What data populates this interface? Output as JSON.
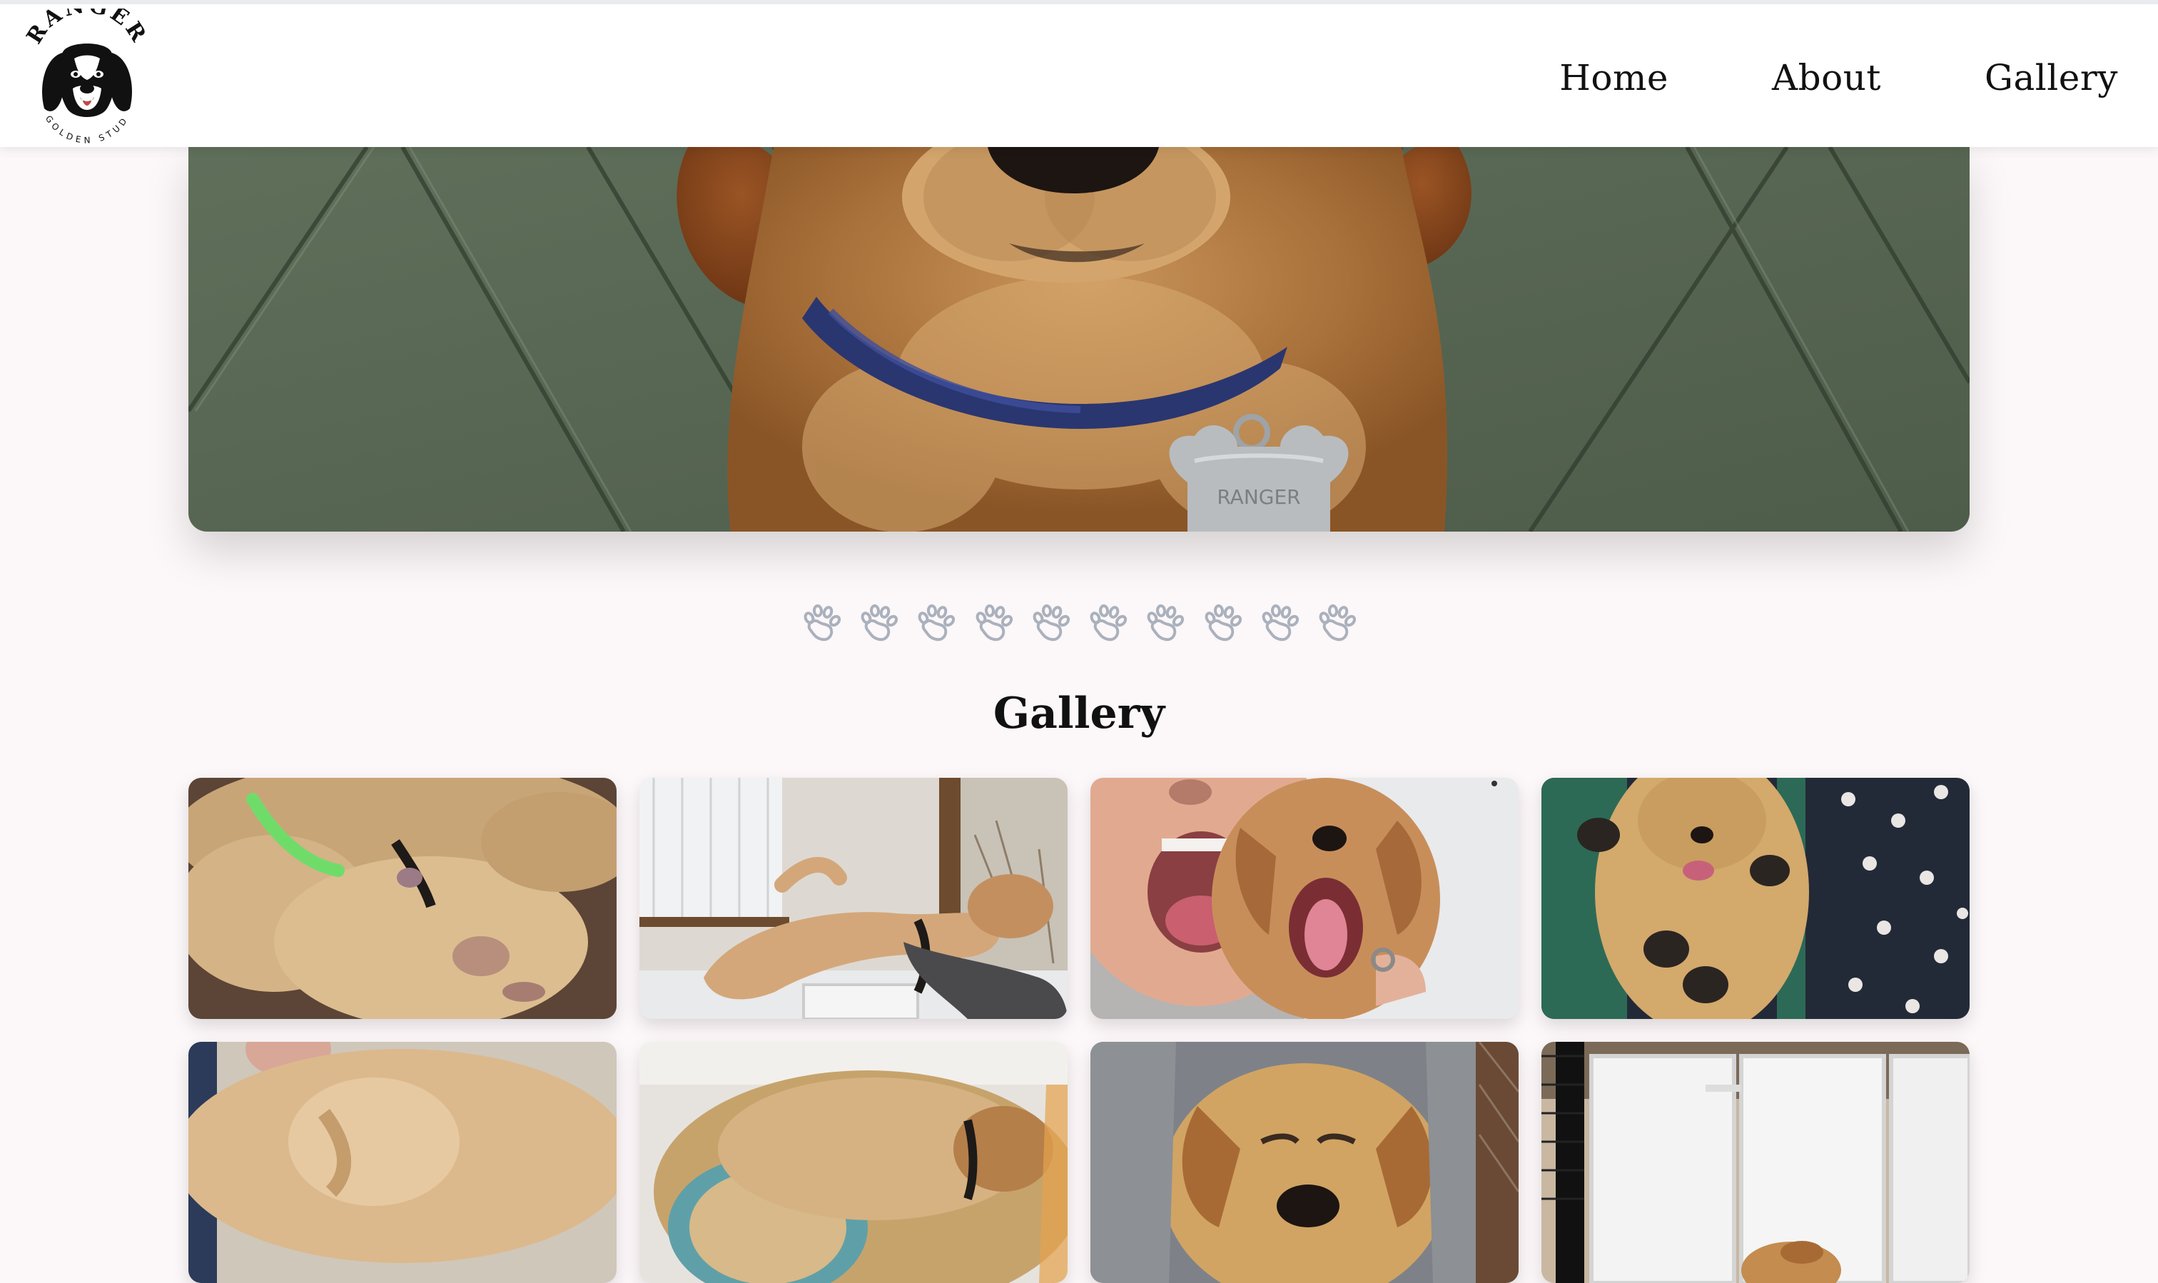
{
  "site": {
    "logo": {
      "name": "RANGER",
      "subtitle": "GOLDEN STUD",
      "icon": "golden-retriever-head-icon"
    }
  },
  "nav": {
    "items": [
      {
        "label": "Home"
      },
      {
        "label": "About"
      },
      {
        "label": "Gallery"
      }
    ]
  },
  "hero": {
    "image": "golden-retriever-puppy-closeup",
    "tag_text": "RANGER"
  },
  "divider": {
    "icon": "paw-print-icon",
    "count": 10,
    "color": "#aab1bd"
  },
  "gallery": {
    "title": "Gallery",
    "images": [
      {
        "subject": "sleeping-puppies-with-collars"
      },
      {
        "subject": "puppy-held-by-hand-near-window"
      },
      {
        "subject": "person-yawning-with-puppy"
      },
      {
        "subject": "puppy-paws-up-on-blanket"
      },
      {
        "subject": "sleeping-puppy-on-blanket"
      },
      {
        "subject": "puppy-lying-in-basket"
      },
      {
        "subject": "puppy-wrapped-in-towel"
      },
      {
        "subject": "puppy-in-white-pen"
      }
    ]
  },
  "colors": {
    "page_background": "#fcf7f8",
    "header_background": "#ffffff",
    "text": "#111111",
    "paw": "#aab1bd"
  }
}
